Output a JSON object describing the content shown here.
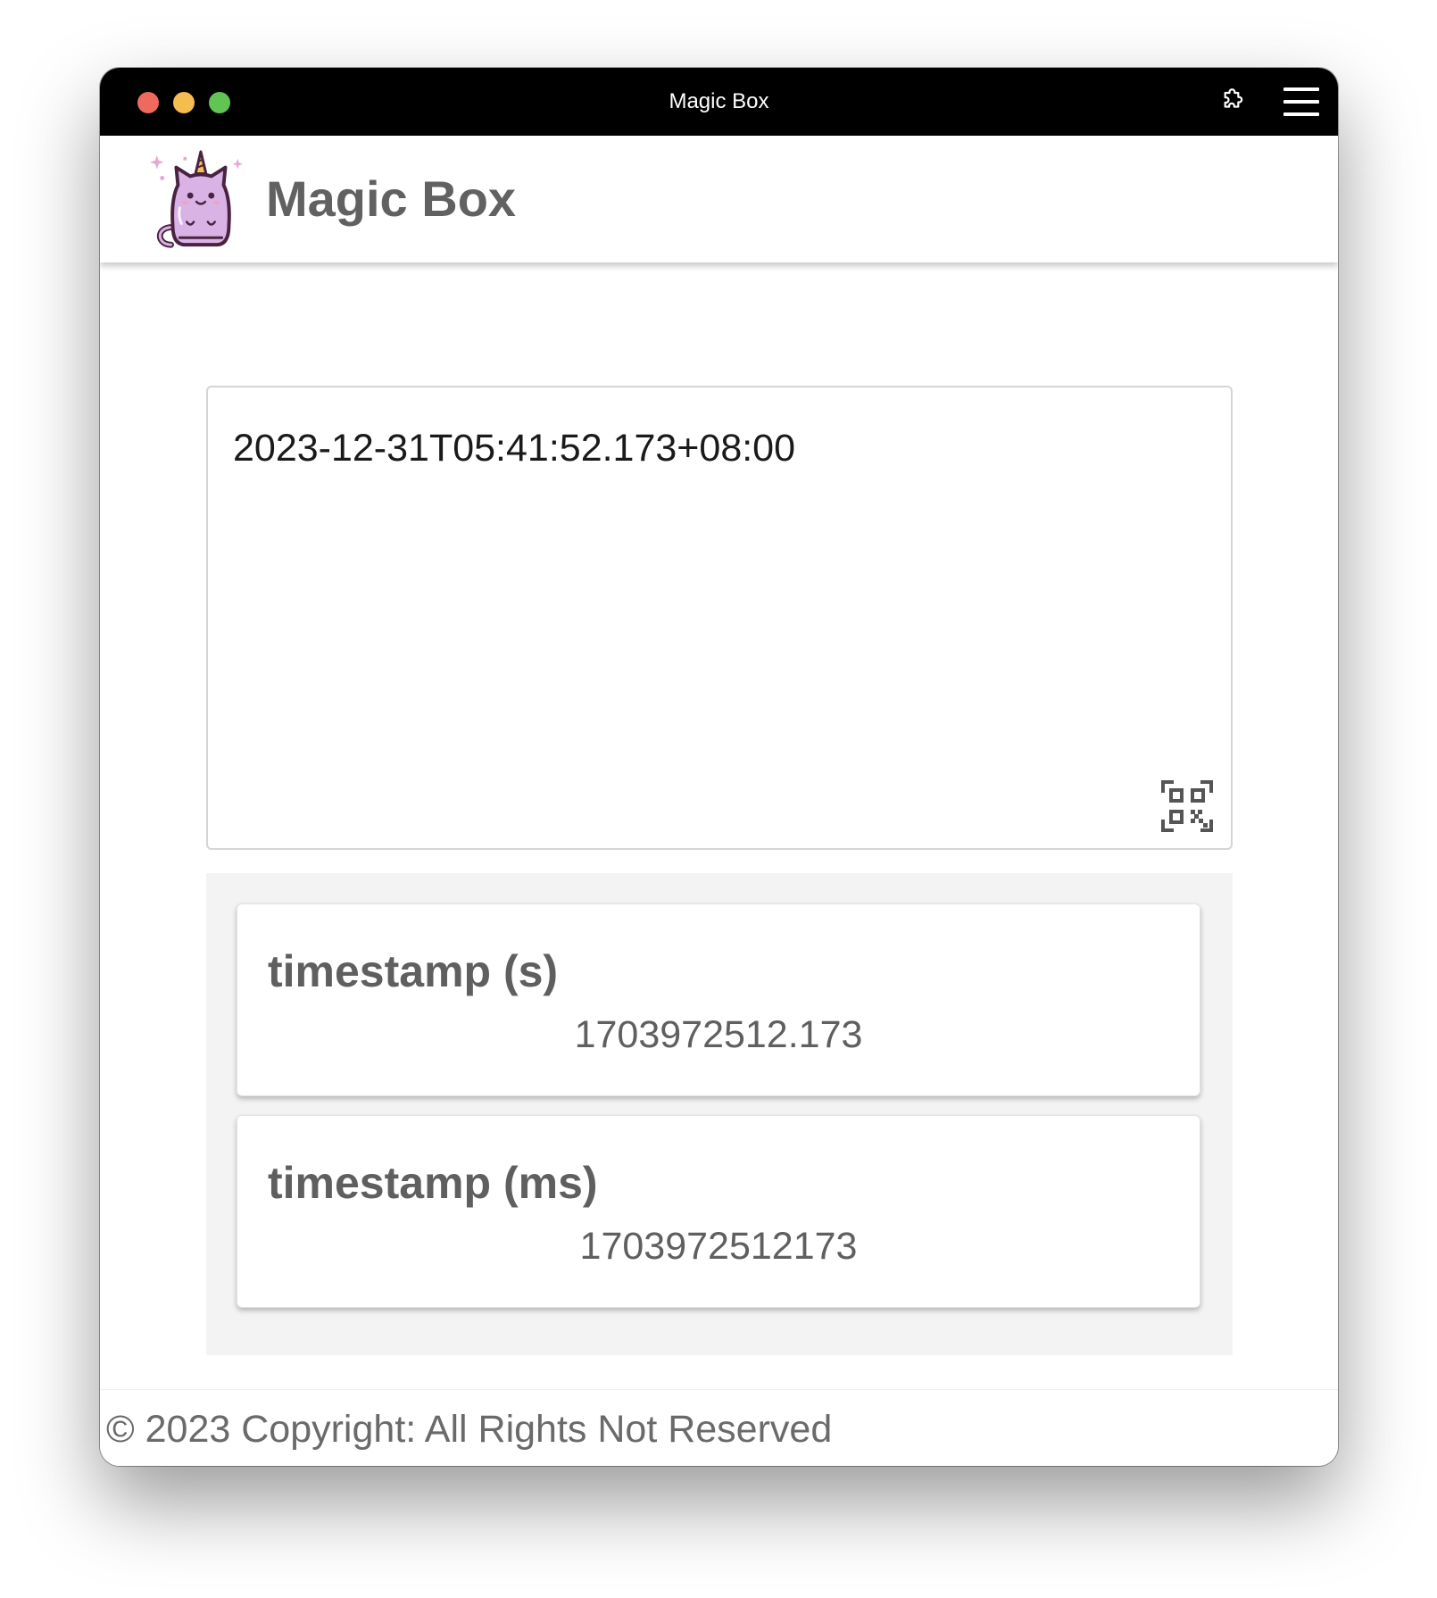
{
  "window": {
    "title": "Magic Box",
    "controls": [
      "close",
      "minimize",
      "zoom"
    ],
    "extension_icon": "puzzle-piece-icon",
    "menu_icon": "hamburger-menu-icon"
  },
  "header": {
    "title": "Magic Box",
    "logo": "unicorn-cat-logo"
  },
  "input": {
    "value": "2023-12-31T05:41:52.173+08:00",
    "qr_icon": "qr-code-scan-icon"
  },
  "results": [
    {
      "label": "timestamp (s)",
      "value": "1703972512.173"
    },
    {
      "label": "timestamp (ms)",
      "value": "1703972512173"
    }
  ],
  "footer": {
    "text": "© 2023 Copyright: All Rights Not Reserved"
  },
  "colors": {
    "titlebar": "#000000",
    "close": "#ee6a5e",
    "minimize": "#f5bd4f",
    "zoom": "#61c554",
    "text_gray": "#616161",
    "results_bg": "#f3f3f3",
    "logo_purple": "#d9b3e6"
  }
}
